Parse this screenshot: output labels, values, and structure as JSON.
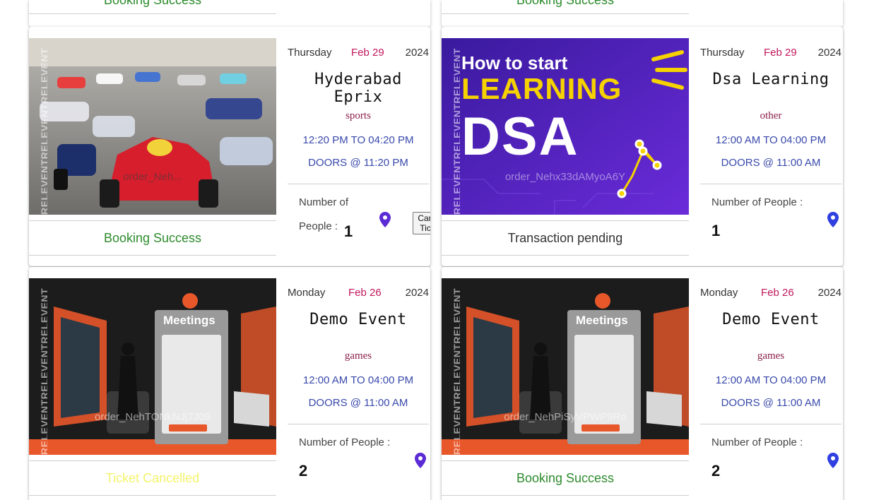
{
  "top_cards": [
    {
      "status": "Booking Success"
    },
    {
      "status": "Booking Success"
    }
  ],
  "cards": [
    {
      "day": "Thursday",
      "month_day": "Feb 29",
      "year": "2024",
      "title": "Hyderabad Eprix",
      "category": "sports",
      "time": "12:20 PM TO 04:20 PM",
      "doors": "DOORS @ 11:20 PM",
      "people_label": "Number of People :",
      "people": "1",
      "order": "order_Neh...",
      "watermark": "RELEVENTRELEVENTRELEVENT",
      "status": "Booking Success",
      "status_color": "#2e8b2e",
      "cancel_label": "Cancel Ticket",
      "image": "formula-e-race"
    },
    {
      "day": "Thursday",
      "month_day": "Feb 29",
      "year": "2024",
      "title": "Dsa Learning",
      "category": "other",
      "time": "12:00 AM TO 04:00 PM",
      "doors": "DOORS @ 11:00 AM",
      "people_label": "Number of People :",
      "people": "1",
      "order": "order_Nehx33dAMyoA6Y",
      "watermark": "RELEVENTRELEVENTRELEVENT",
      "status": "Transaction pending",
      "status_color": "#333333",
      "image": "dsa-banner",
      "banner_line1": "How to start",
      "banner_line2": "LEARNING",
      "banner_line3": "DSA"
    },
    {
      "day": "Monday",
      "month_day": "Feb 26",
      "year": "2024",
      "title": "Demo Event",
      "category": "games",
      "time": "12:00 AM TO 04:00 PM",
      "doors": "DOORS @ 11:00 AM",
      "people_label": "Number of People :",
      "people": "2",
      "order": "order_NehTONkNJj7J09",
      "watermark": "RELEVENTRELEVENTRELEVENT",
      "status": "Ticket Cancelled",
      "status_color": "#f3f36b",
      "image": "virtual-meeting",
      "sign": "Meetings"
    },
    {
      "day": "Monday",
      "month_day": "Feb 26",
      "year": "2024",
      "title": "Demo Event",
      "category": "games",
      "time": "12:00 AM TO 04:00 PM",
      "doors": "DOORS @ 11:00 AM",
      "people_label": "Number of People :",
      "people": "2",
      "order": "order_NehPiSyVPWP9Ro",
      "watermark": "RELEVENTRELEVENTRELEVENT",
      "status": "Booking Success",
      "status_color": "#2e8b2e",
      "image": "virtual-meeting",
      "sign": "Meetings"
    }
  ],
  "colors": {
    "date_accent": "#c2185b",
    "time_text": "#3949ab",
    "pin": "#5b2bd6",
    "pin_blue": "#2f3fe0"
  }
}
